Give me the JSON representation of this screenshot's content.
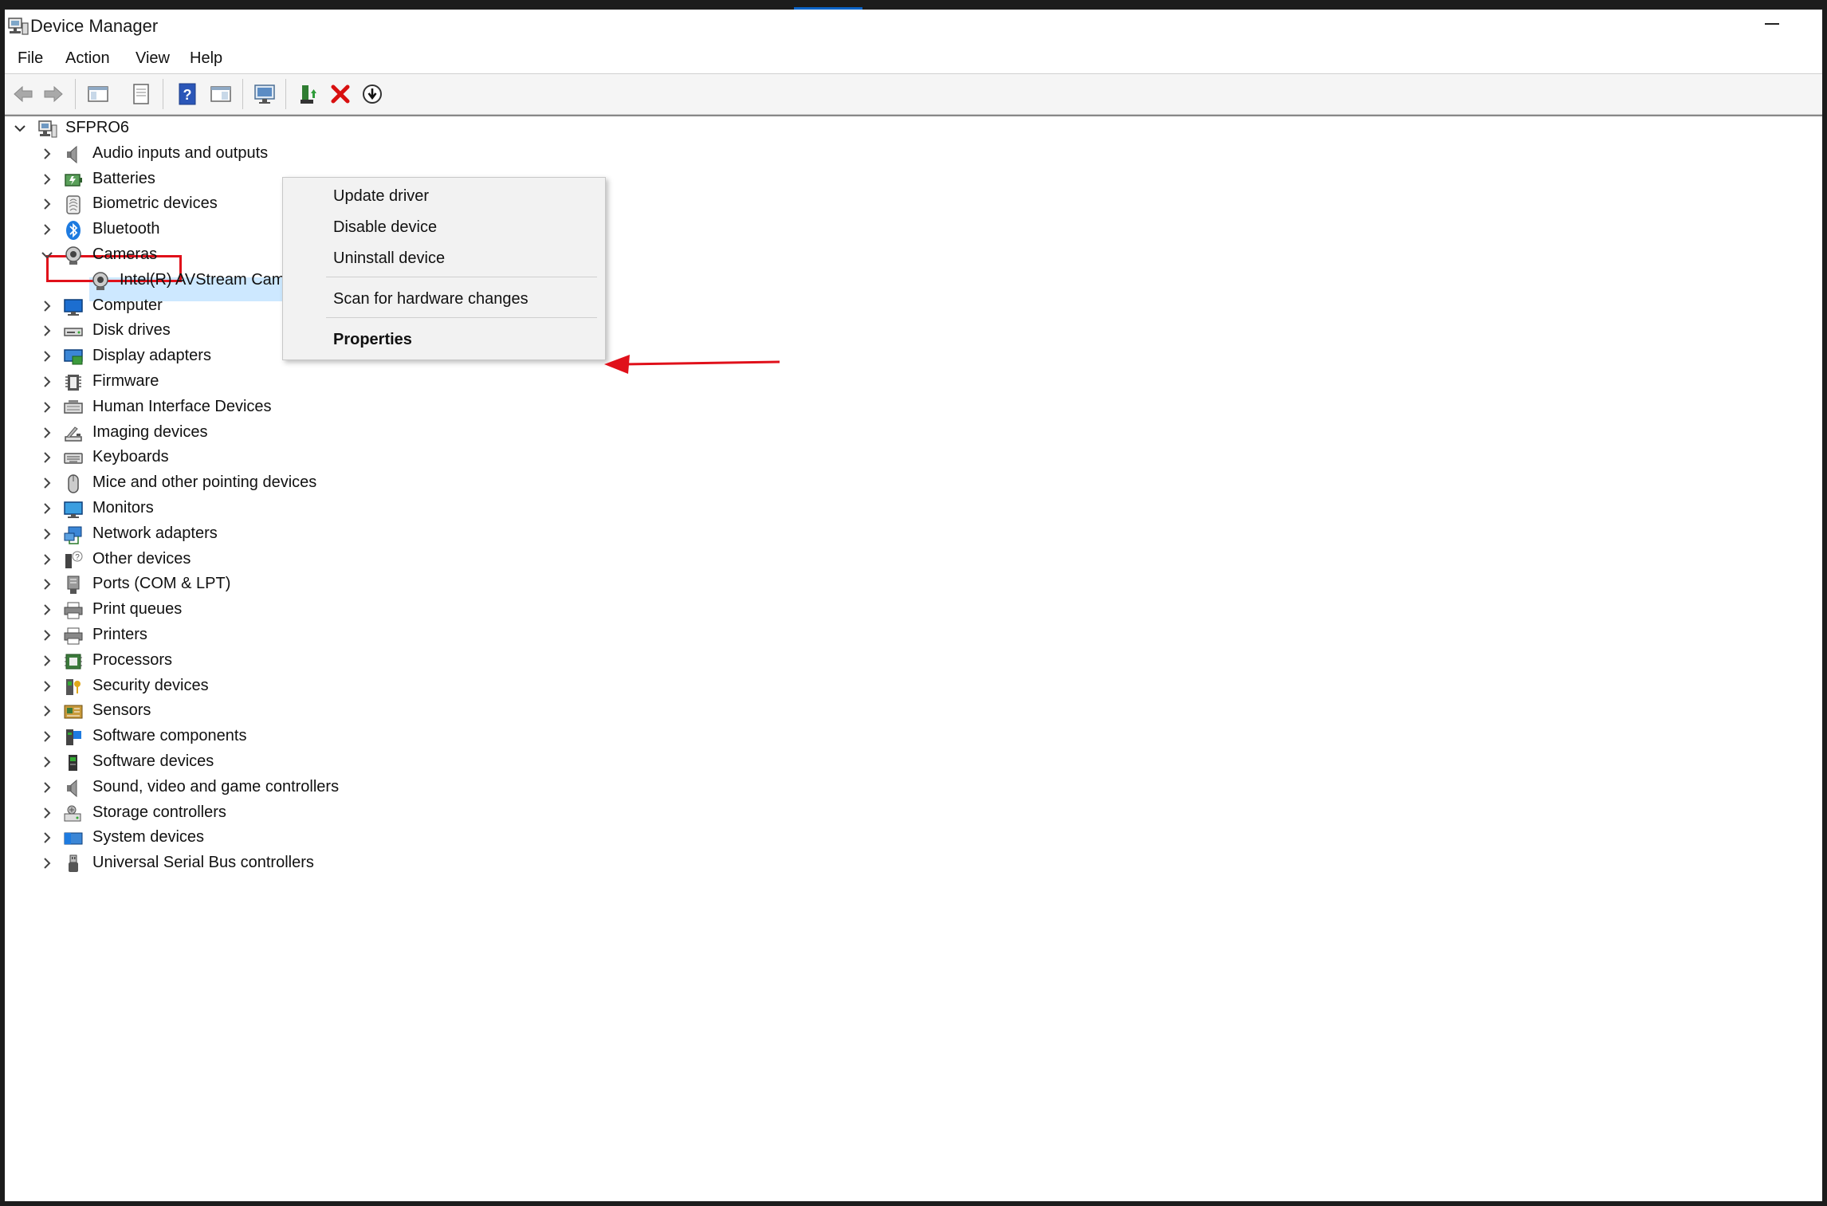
{
  "window": {
    "title": "Device Manager"
  },
  "menubar": {
    "items": [
      "File",
      "Action",
      "View",
      "Help"
    ]
  },
  "toolbar": {
    "buttons": [
      "back-arrow-icon",
      "forward-arrow-icon",
      "show-hide-console-tree-icon",
      "properties-icon",
      "help-icon",
      "action-pane-icon",
      "scan-hardware-icon",
      "update-driver-icon",
      "uninstall-device-icon",
      "disable-device-icon"
    ]
  },
  "tree": {
    "root": "SFPRO6",
    "categories": [
      {
        "label": "Audio inputs and outputs",
        "icon": "speaker-icon"
      },
      {
        "label": "Batteries",
        "icon": "battery-icon"
      },
      {
        "label": "Biometric devices",
        "icon": "fingerprint-icon"
      },
      {
        "label": "Bluetooth",
        "icon": "bluetooth-icon"
      },
      {
        "label": "Cameras",
        "icon": "camera-icon",
        "expanded": true
      },
      {
        "label": "Computer",
        "icon": "computer-icon"
      },
      {
        "label": "Disk drives",
        "icon": "disk-drive-icon"
      },
      {
        "label": "Display adapters",
        "icon": "display-adapter-icon"
      },
      {
        "label": "Firmware",
        "icon": "firmware-icon"
      },
      {
        "label": "Human Interface Devices",
        "icon": "hid-icon"
      },
      {
        "label": "Imaging devices",
        "icon": "scanner-icon"
      },
      {
        "label": "Keyboards",
        "icon": "keyboard-icon"
      },
      {
        "label": "Mice and other pointing devices",
        "icon": "mouse-icon"
      },
      {
        "label": "Monitors",
        "icon": "monitor-icon"
      },
      {
        "label": "Network adapters",
        "icon": "network-icon"
      },
      {
        "label": "Other devices",
        "icon": "unknown-device-icon"
      },
      {
        "label": "Ports (COM & LPT)",
        "icon": "port-icon"
      },
      {
        "label": "Print queues",
        "icon": "printer-icon"
      },
      {
        "label": "Printers",
        "icon": "printer-icon"
      },
      {
        "label": "Processors",
        "icon": "processor-icon"
      },
      {
        "label": "Security devices",
        "icon": "security-key-icon"
      },
      {
        "label": "Sensors",
        "icon": "sensor-icon"
      },
      {
        "label": "Software components",
        "icon": "software-component-icon"
      },
      {
        "label": "Software devices",
        "icon": "software-device-icon"
      },
      {
        "label": "Sound, video and game controllers",
        "icon": "speaker-icon"
      },
      {
        "label": "Storage controllers",
        "icon": "storage-controller-icon"
      },
      {
        "label": "System devices",
        "icon": "system-device-icon"
      },
      {
        "label": "Universal Serial Bus controllers",
        "icon": "usb-icon"
      }
    ],
    "camera_child": "Intel(R) AVStream Cam"
  },
  "context_menu": {
    "items": [
      "Update driver",
      "Disable device",
      "Uninstall device",
      "Scan for hardware changes",
      "Properties"
    ]
  },
  "colors": {
    "selection": "#cde8ff",
    "annotation_red": "#e0101a",
    "accent": "#0a64c8"
  }
}
